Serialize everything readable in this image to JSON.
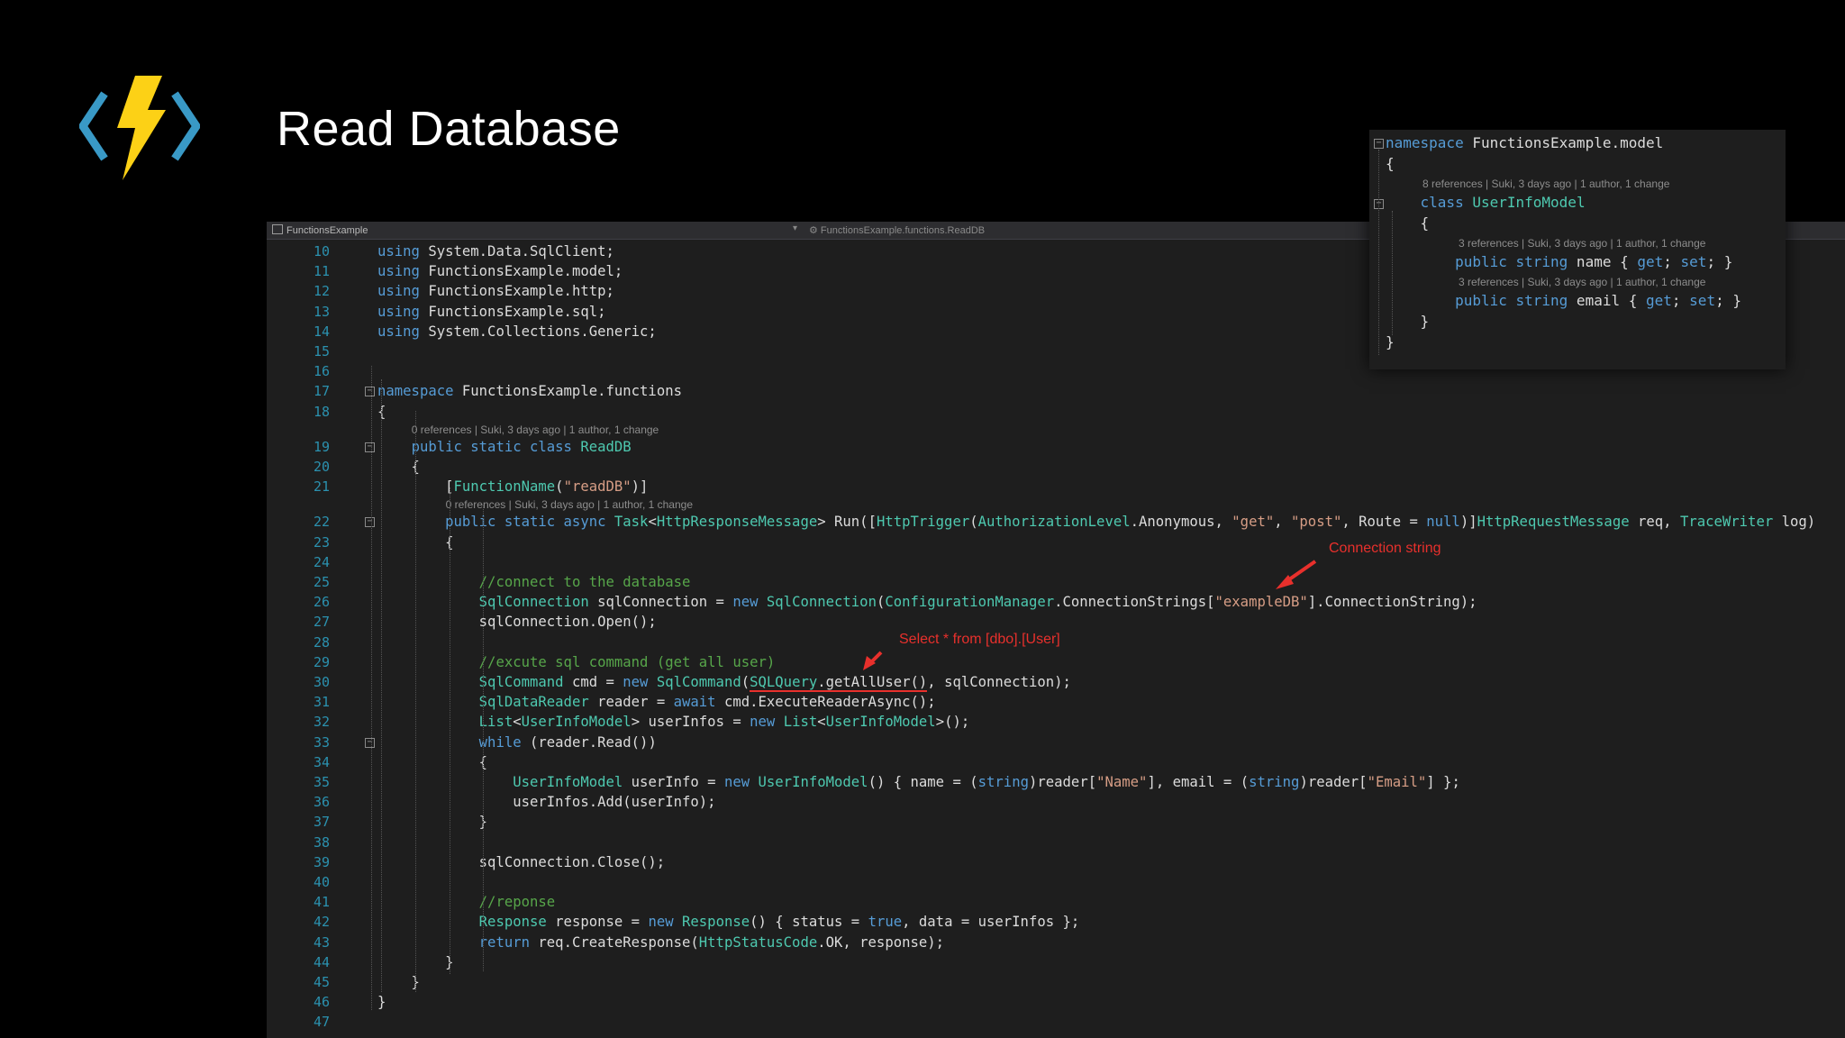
{
  "slide": {
    "title": "Read Database"
  },
  "logo": {
    "icon": "azure-functions-lightning-icon",
    "colors": {
      "bolt": "#fcd116",
      "brackets": "#3999c6"
    }
  },
  "editor": {
    "tab_left": "FunctionsExample",
    "tab_right": "FunctionsExample.functions.ReadDB",
    "lines": [
      {
        "n": "10",
        "t": [
          [
            "kw",
            "using"
          ],
          [
            "nm",
            " System.Data.SqlClient;"
          ]
        ]
      },
      {
        "n": "11",
        "t": [
          [
            "kw",
            "using"
          ],
          [
            "nm",
            " FunctionsExample.model;"
          ]
        ]
      },
      {
        "n": "12",
        "t": [
          [
            "kw",
            "using"
          ],
          [
            "nm",
            " FunctionsExample.http;"
          ]
        ]
      },
      {
        "n": "13",
        "t": [
          [
            "kw",
            "using"
          ],
          [
            "nm",
            " FunctionsExample.sql;"
          ]
        ]
      },
      {
        "n": "14",
        "t": [
          [
            "kw",
            "using"
          ],
          [
            "nm",
            " System.Collections.Generic;"
          ]
        ]
      },
      {
        "n": "15",
        "t": []
      },
      {
        "n": "16",
        "t": []
      },
      {
        "n": "17",
        "t": [
          [
            "kw",
            "namespace"
          ],
          [
            "nm",
            " FunctionsExample.functions"
          ]
        ]
      },
      {
        "n": "18",
        "t": [
          [
            "nm",
            "{"
          ]
        ]
      },
      {
        "n": "19",
        "lens": "0 references | Suki, 3 days ago | 1 author, 1 change",
        "t": [
          [
            "nm",
            "    "
          ],
          [
            "kw",
            "public static class"
          ],
          [
            "nm",
            " "
          ],
          [
            "ty",
            "ReadDB"
          ]
        ]
      },
      {
        "n": "20",
        "t": [
          [
            "nm",
            "    {"
          ]
        ]
      },
      {
        "n": "21",
        "t": [
          [
            "nm",
            "        ["
          ],
          [
            "ty",
            "FunctionName"
          ],
          [
            "nm",
            "("
          ],
          [
            "st",
            "\"readDB\""
          ],
          [
            "nm",
            ")]"
          ]
        ]
      },
      {
        "n": "22",
        "lens": "0 references | Suki, 3 days ago | 1 author, 1 change",
        "t": [
          [
            "nm",
            "        "
          ],
          [
            "kw",
            "public static async"
          ],
          [
            "nm",
            " "
          ],
          [
            "ty",
            "Task"
          ],
          [
            "nm",
            "<"
          ],
          [
            "ty",
            "HttpResponseMessage"
          ],
          [
            "nm",
            "> Run(["
          ],
          [
            "ty",
            "HttpTrigger"
          ],
          [
            "nm",
            "("
          ],
          [
            "ty",
            "AuthorizationLevel"
          ],
          [
            "nm",
            ".Anonymous, "
          ],
          [
            "st",
            "\"get\""
          ],
          [
            "nm",
            ", "
          ],
          [
            "st",
            "\"post\""
          ],
          [
            "nm",
            ", Route = "
          ],
          [
            "kw",
            "null"
          ],
          [
            "nm",
            ")]"
          ],
          [
            "ty",
            "HttpRequestMessage"
          ],
          [
            "nm",
            " req, "
          ],
          [
            "ty",
            "TraceWriter"
          ],
          [
            "nm",
            " log)"
          ]
        ]
      },
      {
        "n": "23",
        "t": [
          [
            "nm",
            "        {"
          ]
        ]
      },
      {
        "n": "24",
        "t": []
      },
      {
        "n": "25",
        "t": [
          [
            "nm",
            "            "
          ],
          [
            "cm",
            "//connect to the database"
          ]
        ]
      },
      {
        "n": "26",
        "t": [
          [
            "nm",
            "            "
          ],
          [
            "ty",
            "SqlConnection"
          ],
          [
            "nm",
            " sqlConnection = "
          ],
          [
            "kw",
            "new"
          ],
          [
            "nm",
            " "
          ],
          [
            "ty",
            "SqlConnection"
          ],
          [
            "nm",
            "("
          ],
          [
            "ty",
            "ConfigurationManager"
          ],
          [
            "nm",
            ".ConnectionStrings["
          ],
          [
            "st",
            "\"exampleDB\""
          ],
          [
            "nm",
            "].ConnectionString);"
          ]
        ]
      },
      {
        "n": "27",
        "t": [
          [
            "nm",
            "            sqlConnection.Open();"
          ]
        ]
      },
      {
        "n": "28",
        "t": []
      },
      {
        "n": "29",
        "t": [
          [
            "nm",
            "            "
          ],
          [
            "cm",
            "//excute sql command (get all user)"
          ]
        ]
      },
      {
        "n": "30",
        "t": [
          [
            "nm",
            "            "
          ],
          [
            "ty",
            "SqlCommand"
          ],
          [
            "nm",
            " cmd = "
          ],
          [
            "kw",
            "new"
          ],
          [
            "nm",
            " "
          ],
          [
            "ty",
            "SqlCommand"
          ],
          [
            "nm",
            "("
          ],
          [
            "ul-ty",
            "SQLQuery"
          ],
          [
            "ul-nm",
            ".getAllUser()"
          ],
          [
            "nm",
            ", sqlConnection);"
          ]
        ]
      },
      {
        "n": "31",
        "t": [
          [
            "nm",
            "            "
          ],
          [
            "ty",
            "SqlDataReader"
          ],
          [
            "nm",
            " reader = "
          ],
          [
            "kw",
            "await"
          ],
          [
            "nm",
            " cmd.ExecuteReaderAsync();"
          ]
        ]
      },
      {
        "n": "32",
        "t": [
          [
            "nm",
            "            "
          ],
          [
            "ty",
            "List"
          ],
          [
            "nm",
            "<"
          ],
          [
            "ty",
            "UserInfoModel"
          ],
          [
            "nm",
            "> userInfos = "
          ],
          [
            "kw",
            "new"
          ],
          [
            "nm",
            " "
          ],
          [
            "ty",
            "List"
          ],
          [
            "nm",
            "<"
          ],
          [
            "ty",
            "UserInfoModel"
          ],
          [
            "nm",
            ">();"
          ]
        ]
      },
      {
        "n": "33",
        "t": [
          [
            "nm",
            "            "
          ],
          [
            "kw",
            "while"
          ],
          [
            "nm",
            " (reader.Read())"
          ]
        ]
      },
      {
        "n": "34",
        "t": [
          [
            "nm",
            "            {"
          ]
        ]
      },
      {
        "n": "35",
        "t": [
          [
            "nm",
            "                "
          ],
          [
            "ty",
            "UserInfoModel"
          ],
          [
            "nm",
            " userInfo = "
          ],
          [
            "kw",
            "new"
          ],
          [
            "nm",
            " "
          ],
          [
            "ty",
            "UserInfoModel"
          ],
          [
            "nm",
            "() { name = ("
          ],
          [
            "kw",
            "string"
          ],
          [
            "nm",
            ")reader["
          ],
          [
            "st",
            "\"Name\""
          ],
          [
            "nm",
            "], email = ("
          ],
          [
            "kw",
            "string"
          ],
          [
            "nm",
            ")reader["
          ],
          [
            "st",
            "\"Email\""
          ],
          [
            "nm",
            "] };"
          ]
        ]
      },
      {
        "n": "36",
        "t": [
          [
            "nm",
            "                userInfos.Add(userInfo);"
          ]
        ]
      },
      {
        "n": "37",
        "t": [
          [
            "nm",
            "            }"
          ]
        ]
      },
      {
        "n": "38",
        "t": []
      },
      {
        "n": "39",
        "t": [
          [
            "nm",
            "            sqlConnection.Close();"
          ]
        ]
      },
      {
        "n": "40",
        "t": []
      },
      {
        "n": "41",
        "t": [
          [
            "nm",
            "            "
          ],
          [
            "cm",
            "//reponse"
          ]
        ]
      },
      {
        "n": "42",
        "t": [
          [
            "nm",
            "            "
          ],
          [
            "ty",
            "Response"
          ],
          [
            "nm",
            " response = "
          ],
          [
            "kw",
            "new"
          ],
          [
            "nm",
            " "
          ],
          [
            "ty",
            "Response"
          ],
          [
            "nm",
            "() { status = "
          ],
          [
            "kw",
            "true"
          ],
          [
            "nm",
            ", data = userInfos };"
          ]
        ]
      },
      {
        "n": "43",
        "t": [
          [
            "nm",
            "            "
          ],
          [
            "kw",
            "return"
          ],
          [
            "nm",
            " req.CreateResponse("
          ],
          [
            "ty",
            "HttpStatusCode"
          ],
          [
            "nm",
            ".OK, response);"
          ]
        ]
      },
      {
        "n": "44",
        "t": [
          [
            "nm",
            "        }"
          ]
        ]
      },
      {
        "n": "45",
        "t": [
          [
            "nm",
            "    }"
          ]
        ]
      },
      {
        "n": "46",
        "t": [
          [
            "nm",
            "}"
          ]
        ]
      },
      {
        "n": "47",
        "t": []
      }
    ]
  },
  "annotations": {
    "connection_string": "Connection string",
    "select_query": "Select * from [dbo].[User]",
    "color": "#e8302c"
  },
  "panel": {
    "lines": [
      {
        "t": [
          [
            "kw",
            "namespace"
          ],
          [
            "nm",
            " FunctionsExample.model"
          ]
        ]
      },
      {
        "t": [
          [
            "nm",
            "{"
          ]
        ]
      },
      {
        "lens": "8 references | Suki, 3 days ago | 1 author, 1 change"
      },
      {
        "t": [
          [
            "nm",
            "    "
          ],
          [
            "kw",
            "class"
          ],
          [
            "nm",
            " "
          ],
          [
            "ty",
            "UserInfoModel"
          ]
        ]
      },
      {
        "t": [
          [
            "nm",
            "    {"
          ]
        ]
      },
      {
        "lens": "3 references | Suki, 3 days ago | 1 author, 1 change"
      },
      {
        "t": [
          [
            "nm",
            "        "
          ],
          [
            "kw",
            "public string"
          ],
          [
            "nm",
            " name { "
          ],
          [
            "kw",
            "get"
          ],
          [
            "nm",
            "; "
          ],
          [
            "kw",
            "set"
          ],
          [
            "nm",
            "; }"
          ]
        ]
      },
      {
        "lens": "3 references | Suki, 3 days ago | 1 author, 1 change"
      },
      {
        "t": [
          [
            "nm",
            "        "
          ],
          [
            "kw",
            "public string"
          ],
          [
            "nm",
            " email { "
          ],
          [
            "kw",
            "get"
          ],
          [
            "nm",
            "; "
          ],
          [
            "kw",
            "set"
          ],
          [
            "nm",
            "; }"
          ]
        ]
      },
      {
        "t": [
          [
            "nm",
            "    }"
          ]
        ]
      },
      {
        "t": [
          [
            "nm",
            "}"
          ]
        ]
      }
    ]
  }
}
